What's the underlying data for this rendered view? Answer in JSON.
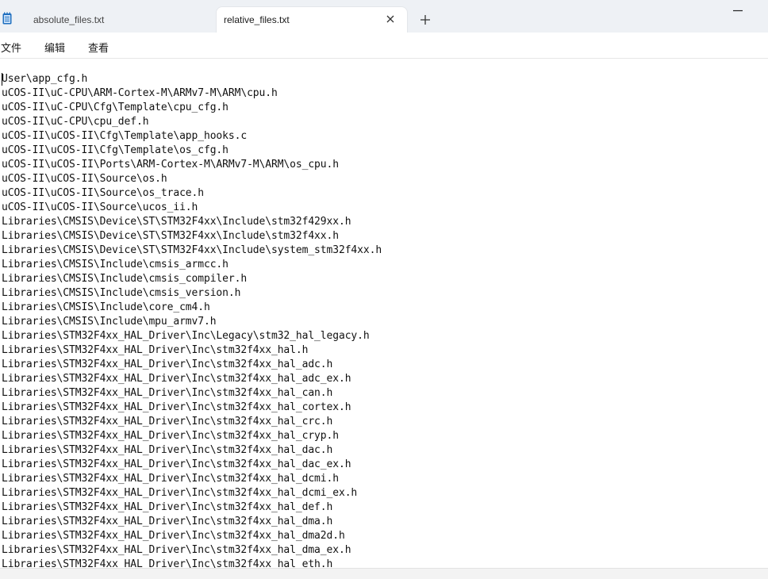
{
  "tabs": [
    {
      "label": "absolute_files.txt",
      "active": false
    },
    {
      "label": "relative_files.txt",
      "active": true
    }
  ],
  "menu": {
    "file": "文件",
    "edit": "编辑",
    "view": "查看"
  },
  "icons": {
    "app": "notepad-icon",
    "close": "close-icon",
    "new_tab": "plus-icon",
    "minimize": "minimize-icon"
  },
  "colors": {
    "tabbar_bg": "#eef1f5",
    "editor_bg": "#ffffff",
    "text": "#111111",
    "app_icon": "#1e6fbf"
  },
  "editor": {
    "lines": [
      "User\\app_cfg.h",
      "uCOS-II\\uC-CPU\\ARM-Cortex-M\\ARMv7-M\\ARM\\cpu.h",
      "uCOS-II\\uC-CPU\\Cfg\\Template\\cpu_cfg.h",
      "uCOS-II\\uC-CPU\\cpu_def.h",
      "uCOS-II\\uCOS-II\\Cfg\\Template\\app_hooks.c",
      "uCOS-II\\uCOS-II\\Cfg\\Template\\os_cfg.h",
      "uCOS-II\\uCOS-II\\Ports\\ARM-Cortex-M\\ARMv7-M\\ARM\\os_cpu.h",
      "uCOS-II\\uCOS-II\\Source\\os.h",
      "uCOS-II\\uCOS-II\\Source\\os_trace.h",
      "uCOS-II\\uCOS-II\\Source\\ucos_ii.h",
      "Libraries\\CMSIS\\Device\\ST\\STM32F4xx\\Include\\stm32f429xx.h",
      "Libraries\\CMSIS\\Device\\ST\\STM32F4xx\\Include\\stm32f4xx.h",
      "Libraries\\CMSIS\\Device\\ST\\STM32F4xx\\Include\\system_stm32f4xx.h",
      "Libraries\\CMSIS\\Include\\cmsis_armcc.h",
      "Libraries\\CMSIS\\Include\\cmsis_compiler.h",
      "Libraries\\CMSIS\\Include\\cmsis_version.h",
      "Libraries\\CMSIS\\Include\\core_cm4.h",
      "Libraries\\CMSIS\\Include\\mpu_armv7.h",
      "Libraries\\STM32F4xx_HAL_Driver\\Inc\\Legacy\\stm32_hal_legacy.h",
      "Libraries\\STM32F4xx_HAL_Driver\\Inc\\stm32f4xx_hal.h",
      "Libraries\\STM32F4xx_HAL_Driver\\Inc\\stm32f4xx_hal_adc.h",
      "Libraries\\STM32F4xx_HAL_Driver\\Inc\\stm32f4xx_hal_adc_ex.h",
      "Libraries\\STM32F4xx_HAL_Driver\\Inc\\stm32f4xx_hal_can.h",
      "Libraries\\STM32F4xx_HAL_Driver\\Inc\\stm32f4xx_hal_cortex.h",
      "Libraries\\STM32F4xx_HAL_Driver\\Inc\\stm32f4xx_hal_crc.h",
      "Libraries\\STM32F4xx_HAL_Driver\\Inc\\stm32f4xx_hal_cryp.h",
      "Libraries\\STM32F4xx_HAL_Driver\\Inc\\stm32f4xx_hal_dac.h",
      "Libraries\\STM32F4xx_HAL_Driver\\Inc\\stm32f4xx_hal_dac_ex.h",
      "Libraries\\STM32F4xx_HAL_Driver\\Inc\\stm32f4xx_hal_dcmi.h",
      "Libraries\\STM32F4xx_HAL_Driver\\Inc\\stm32f4xx_hal_dcmi_ex.h",
      "Libraries\\STM32F4xx_HAL_Driver\\Inc\\stm32f4xx_hal_def.h",
      "Libraries\\STM32F4xx_HAL_Driver\\Inc\\stm32f4xx_hal_dma.h",
      "Libraries\\STM32F4xx_HAL_Driver\\Inc\\stm32f4xx_hal_dma2d.h",
      "Libraries\\STM32F4xx_HAL_Driver\\Inc\\stm32f4xx_hal_dma_ex.h",
      "Libraries\\STM32F4xx_HAL_Driver\\Inc\\stm32f4xx_hal_eth.h"
    ]
  }
}
